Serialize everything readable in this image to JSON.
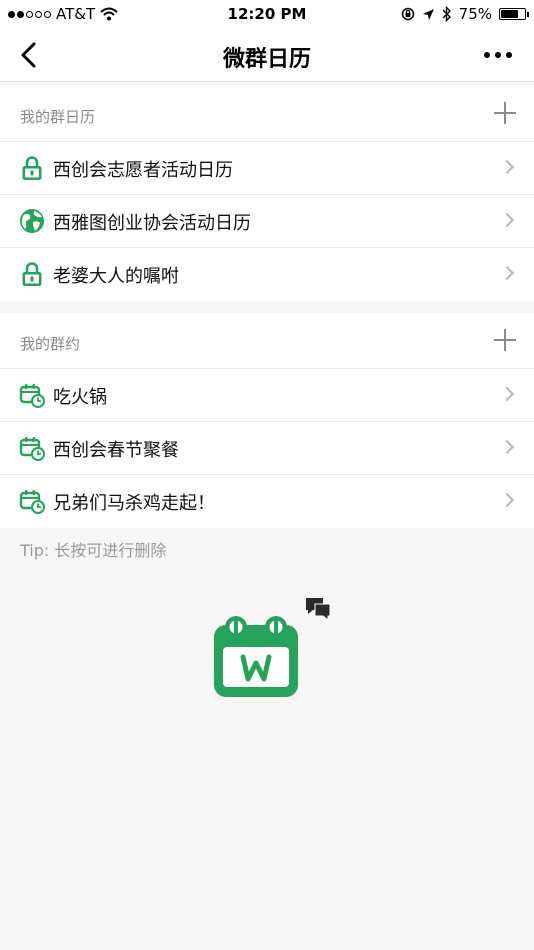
{
  "status_bar": {
    "carrier": "AT&T",
    "time": "12:20 PM",
    "battery_percent": "75%",
    "battery_level": 0.75,
    "signal_bars_on": 2,
    "signal_bars_total": 5
  },
  "nav": {
    "title": "微群日历",
    "back_icon": "chevron-left-icon",
    "more_icon": "more-dots-icon"
  },
  "group_calendars": {
    "title": "我的群日历",
    "items": [
      {
        "label": "西创会志愿者活动日历",
        "icon": "lock-icon"
      },
      {
        "label": "西雅图创业协会活动日历",
        "icon": "globe-icon"
      },
      {
        "label": "老婆大人的嘱咐",
        "icon": "lock-icon"
      }
    ]
  },
  "group_events": {
    "title": "我的群约",
    "items": [
      {
        "label": "吃火锅",
        "icon": "calendar-clock-icon"
      },
      {
        "label": "西创会春节聚餐",
        "icon": "calendar-clock-icon"
      },
      {
        "label": "兄弟们马杀鸡走起！",
        "icon": "calendar-clock-icon"
      }
    ]
  },
  "tip": "Tip: 长按可进行删除",
  "colors": {
    "brand_green": "#25a35a",
    "background": "#f6f6f6",
    "secondary_text": "#8a8a8a"
  }
}
